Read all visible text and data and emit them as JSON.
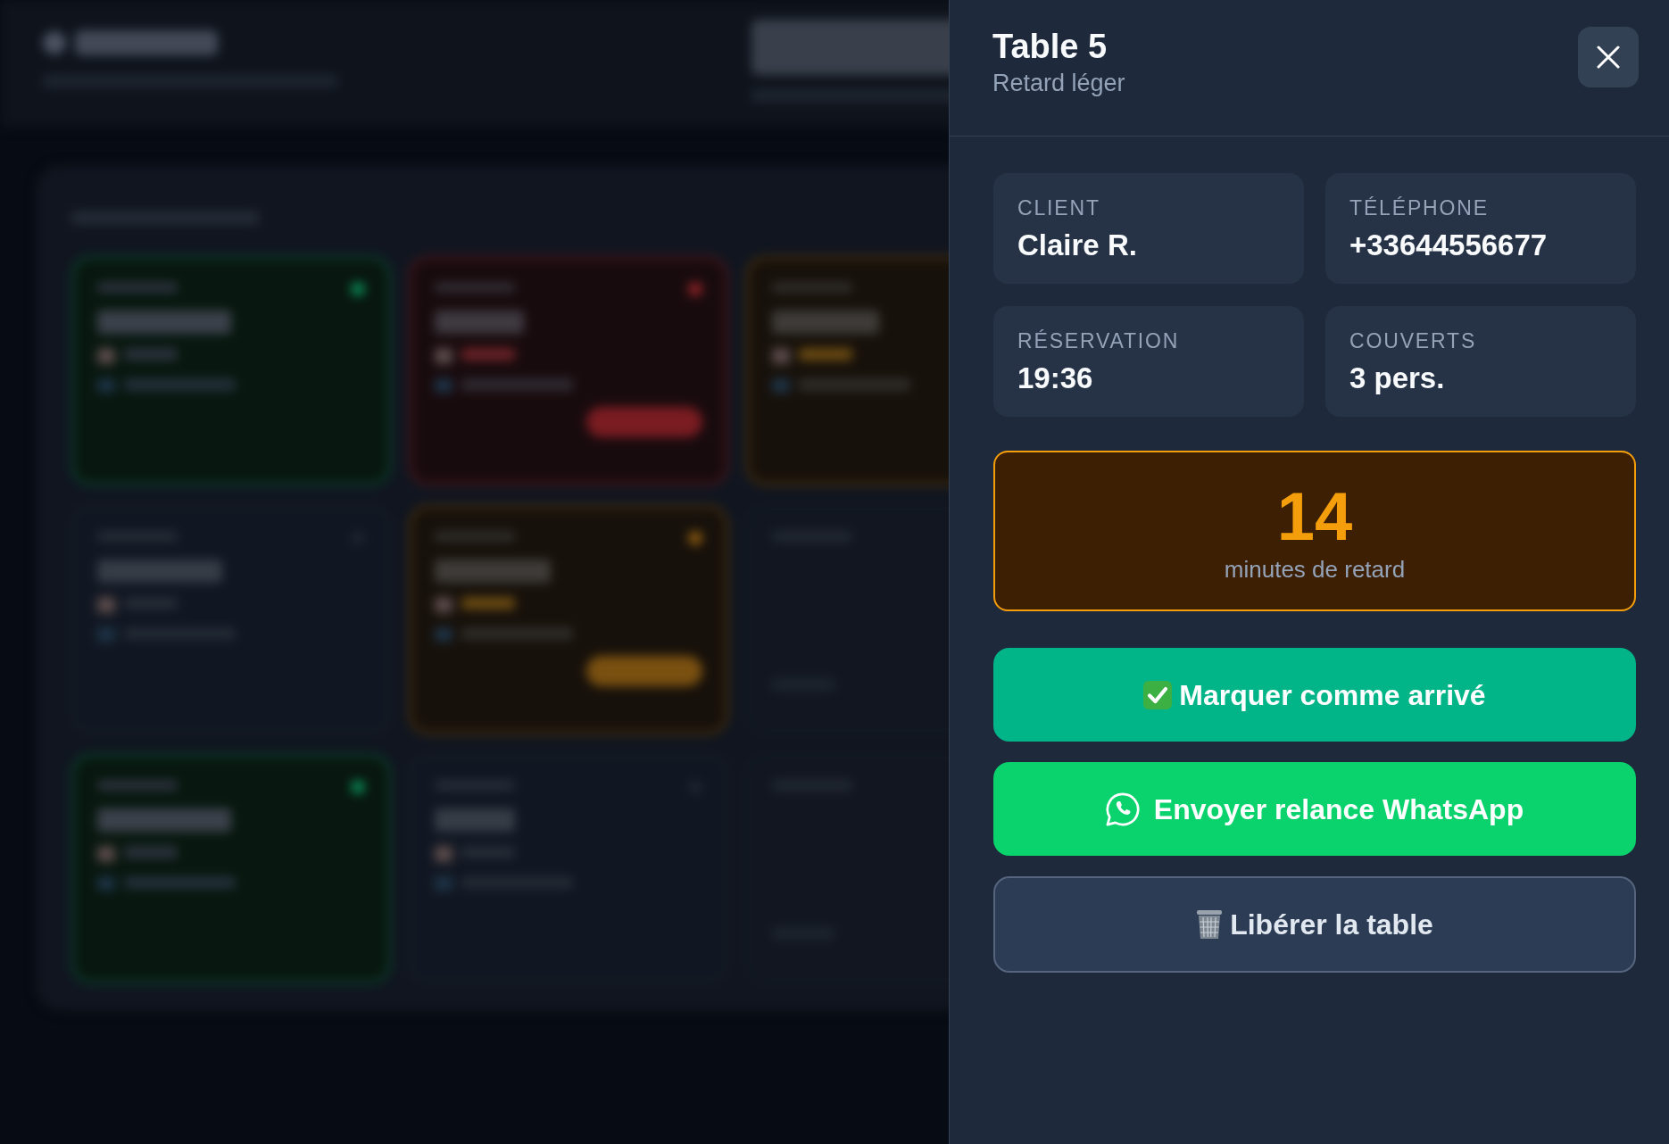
{
  "panel": {
    "title": "Table 5",
    "subtitle": "Retard léger"
  },
  "details": [
    {
      "label": "CLIENT",
      "value": "Claire R."
    },
    {
      "label": "TÉLÉPHONE",
      "value": "+33644556677"
    },
    {
      "label": "RÉSERVATION",
      "value": "19:36"
    },
    {
      "label": "COUVERTS",
      "value": "3 pers."
    }
  ],
  "delay": {
    "minutes": "14",
    "caption": "minutes de retard"
  },
  "actions": [
    {
      "kind": "confirm",
      "label": "Marquer comme arrivé"
    },
    {
      "kind": "message",
      "label": "Envoyer relance WhatsApp"
    },
    {
      "kind": "release",
      "label": "Libérer la table"
    }
  ]
}
